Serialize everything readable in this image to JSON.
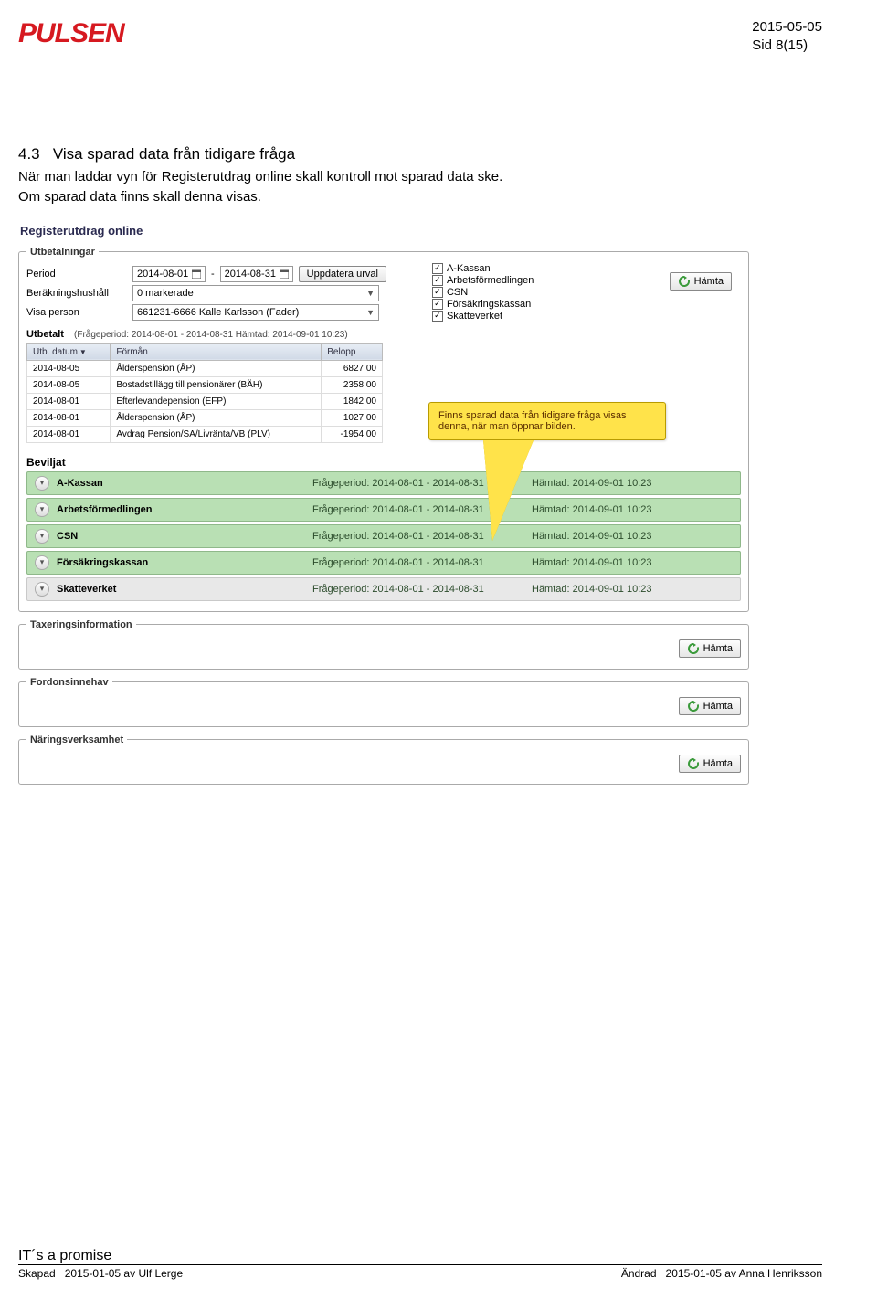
{
  "header": {
    "logo": "PULSEN",
    "date": "2015-05-05",
    "page": "Sid 8(15)"
  },
  "section": {
    "heading_num": "4.3",
    "heading": "Visa sparad data från tidigare fråga",
    "body1": "När man laddar vyn för Registerutdrag online skall kontroll mot sparad data ske.",
    "body2": "Om sparad data finns skall denna visas."
  },
  "app": {
    "title": "Registerutdrag online",
    "utbet": {
      "legend": "Utbetalningar",
      "period_label": "Period",
      "period_from": "2014-08-01",
      "period_sep": "-",
      "period_to": "2014-08-31",
      "update_btn": "Uppdatera urval",
      "household_label": "Beräkningshushåll",
      "household_value": "0 markerade",
      "person_label": "Visa person",
      "person_value": "661231-6666 Kalle Karlsson (Fader)",
      "sources": [
        "A-Kassan",
        "Arbetsförmedlingen",
        "CSN",
        "Försäkringskassan",
        "Skatteverket"
      ],
      "hamta_btn": "Hämta",
      "utbetalt_label": "Utbetalt",
      "utbetalt_meta": "(Frågeperiod: 2014-08-01 - 2014-08-31  Hämtad: 2014-09-01 10:23)",
      "cols": {
        "c1": "Utb. datum",
        "c2": "Förmån",
        "c3": "Belopp"
      },
      "rows": [
        {
          "d": "2014-08-05",
          "f": "Ålderspension (ÅP)",
          "b": "6827,00"
        },
        {
          "d": "2014-08-05",
          "f": "Bostadstillägg till pensionärer (BÄH)",
          "b": "2358,00"
        },
        {
          "d": "2014-08-01",
          "f": "Efterlevandepension (EFP)",
          "b": "1842,00"
        },
        {
          "d": "2014-08-01",
          "f": "Ålderspension (ÅP)",
          "b": "1027,00"
        },
        {
          "d": "2014-08-01",
          "f": "Avdrag Pension/SA/Livränta/VB (PLV)",
          "b": "-1954,00"
        }
      ],
      "callout": "Finns sparad data från tidigare fråga visas denna, när man öppnar bilden.",
      "beviljat_label": "Beviljat",
      "beviljat_rows": [
        {
          "name": "A-Kassan",
          "period": "Frågeperiod: 2014-08-01 - 2014-08-31",
          "fetched": "Hämtad: 2014-09-01 10:23",
          "green": true
        },
        {
          "name": "Arbetsförmedlingen",
          "period": "Frågeperiod: 2014-08-01 - 2014-08-31",
          "fetched": "Hämtad: 2014-09-01 10:23",
          "green": true
        },
        {
          "name": "CSN",
          "period": "Frågeperiod: 2014-08-01 - 2014-08-31",
          "fetched": "Hämtad: 2014-09-01 10:23",
          "green": true
        },
        {
          "name": "Försäkringskassan",
          "period": "Frågeperiod: 2014-08-01 - 2014-08-31",
          "fetched": "Hämtad: 2014-09-01 10:23",
          "green": true
        },
        {
          "name": "Skatteverket",
          "period": "Frågeperiod: 2014-08-01 - 2014-08-31",
          "fetched": "Hämtad: 2014-09-01 10:23",
          "green": false
        }
      ]
    },
    "extra_groups": [
      {
        "legend": "Taxeringsinformation",
        "btn": "Hämta"
      },
      {
        "legend": "Fordonsinnehav",
        "btn": "Hämta"
      },
      {
        "legend": "Näringsverksamhet",
        "btn": "Hämta"
      }
    ]
  },
  "footer": {
    "promise": "IT´s a promise",
    "created_label": "Skapad",
    "created_value": "2015-01-05 av Ulf Lerge",
    "changed_label": "Ändrad",
    "changed_value": "2015-01-05 av Anna Henriksson"
  }
}
